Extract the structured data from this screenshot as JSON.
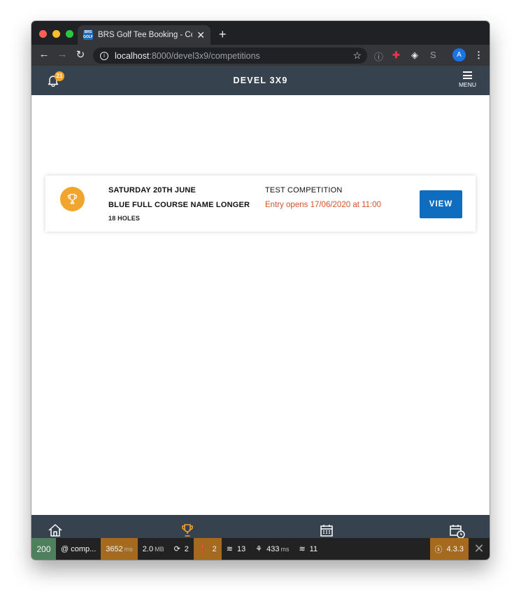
{
  "browser": {
    "tab_title": "BRS Golf Tee Booking - Competitions",
    "favicon_text": "BRS GOLF",
    "new_tab": "+",
    "tab_close": "✕",
    "url_host": "localhost",
    "url_rest": ":8000/devel3x9/competitions",
    "profile_initial": "A"
  },
  "header": {
    "title": "DEVEL 3X9",
    "notifications_count": "21",
    "menu_label": "MENU"
  },
  "competitions": [
    {
      "date": "SATURDAY 20TH JUNE",
      "course": "BLUE FULL COURSE NAME LONGER",
      "holes": "18 HOLES",
      "name": "TEST COMPETITION",
      "entry_status": "Entry opens 17/06/2020 at 11:00",
      "action_label": "VIEW"
    }
  ],
  "bottom_nav": [
    "home-icon",
    "trophy-icon",
    "calendar-icon",
    "calendar-clock-icon"
  ],
  "debugbar": {
    "status": "200",
    "route": "@ comp...",
    "time_value": "3652",
    "time_unit": "ms",
    "memory_value": "2.0",
    "memory_unit": "MB",
    "requests": "2",
    "warnings": "2",
    "layers": "13",
    "render_value": "433",
    "render_unit": "ms",
    "db_queries": "11",
    "version": "4.3.3",
    "close": "✕"
  },
  "colors": {
    "header_bg": "#37424f",
    "accent_orange": "#f2a52c",
    "button_blue": "#0e6dbf",
    "entry_text": "#d0532c"
  }
}
